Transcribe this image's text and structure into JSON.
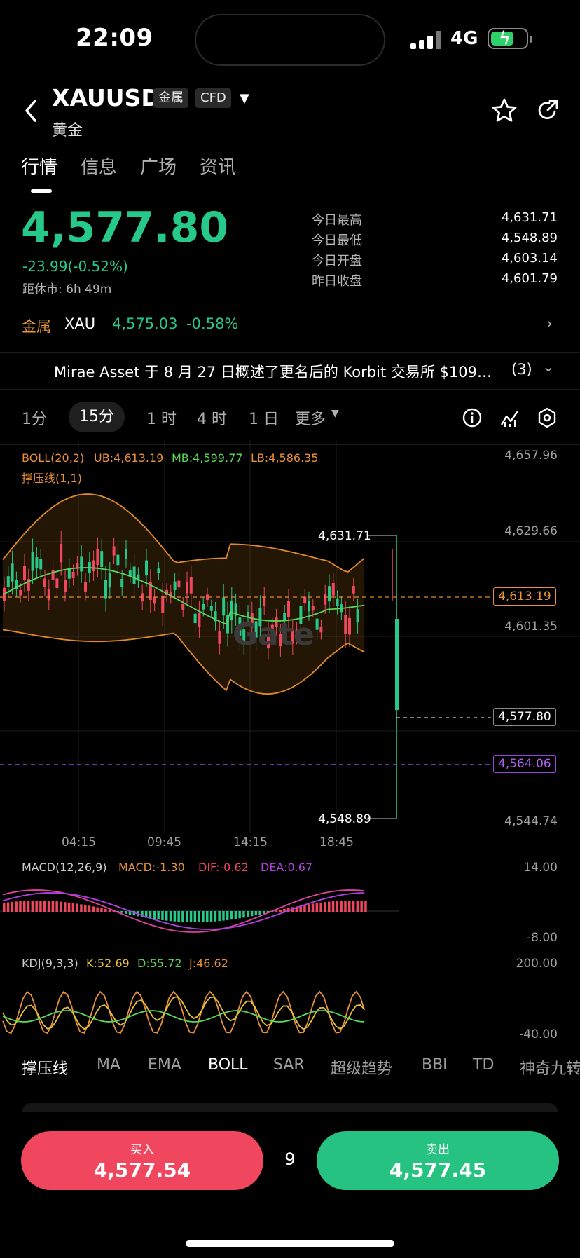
{
  "status": {
    "time": "22:09",
    "network": "4G"
  },
  "header": {
    "symbol": "XAUUSD",
    "tag_metal": "金属",
    "tag_cfd": "CFD",
    "name": "黄金"
  },
  "tabs": [
    "行情",
    "信息",
    "广场",
    "资讯"
  ],
  "quote": {
    "price": "4,577.80",
    "change": "-23.99(-0.52%)",
    "close_label": "距休市: 6h 49m",
    "stats": [
      {
        "label": "今日最高",
        "value": "4,631.71"
      },
      {
        "label": "今日最低",
        "value": "4,548.89"
      },
      {
        "label": "今日开盘",
        "value": "4,603.14"
      },
      {
        "label": "昨日收盘",
        "value": "4,601.79"
      }
    ]
  },
  "metal_row": {
    "label": "金属",
    "symbol": "XAU",
    "price": "4,575.03",
    "change": "-0.58%"
  },
  "news": {
    "text": "Mirae Asset 于 8 月 27 日概述了更名后的 Korbit 交易所 $109…",
    "count": "(3)"
  },
  "intervals": [
    "1分",
    "15分",
    "1 时",
    "4 时",
    "1 日",
    "更多"
  ],
  "boll": {
    "label": "BOLL(20,2)",
    "ub": "UB:4,613.19",
    "mb": "MB:4,599.77",
    "lb": "LB:4,586.35",
    "sr": "撑压线(1,1)"
  },
  "price_axis": [
    "4,657.96",
    "4,629.66",
    "4,601.35",
    "4,544.74"
  ],
  "price_labels": {
    "high": "4,631.71",
    "low": "4,548.89",
    "ub": "4,613.19",
    "last": "4,577.80",
    "support": "4,564.06"
  },
  "time_axis": [
    "04:15",
    "09:45",
    "14:15",
    "18:45"
  ],
  "watermark": "Gate",
  "macd": {
    "label": "MACD(12,26,9)",
    "macd": "MACD:-1.30",
    "dif": "DIF:-0.62",
    "dea": "DEA:0.67",
    "top": "14.00",
    "bottom": "-8.00"
  },
  "kdj": {
    "label": "KDJ(9,3,3)",
    "k": "K:52.69",
    "d": "D:55.72",
    "j": "J:46.62",
    "top": "200.00",
    "bottom": "-40.00"
  },
  "bottom_tabs": [
    "撑压线",
    "MA",
    "EMA",
    "BOLL",
    "SAR",
    "超级趋势",
    "BBI",
    "TD",
    "神奇九转"
  ],
  "trade": {
    "buy_label": "买入",
    "buy_price": "4,577.54",
    "spread": "9",
    "sell_label": "卖出",
    "sell_price": "4,577.45"
  },
  "colors": {
    "up": "#27c98b",
    "down": "#f0475f",
    "boll_band": "#e08a2a",
    "mid": "#5ad65a",
    "support": "#9b40e0"
  }
}
